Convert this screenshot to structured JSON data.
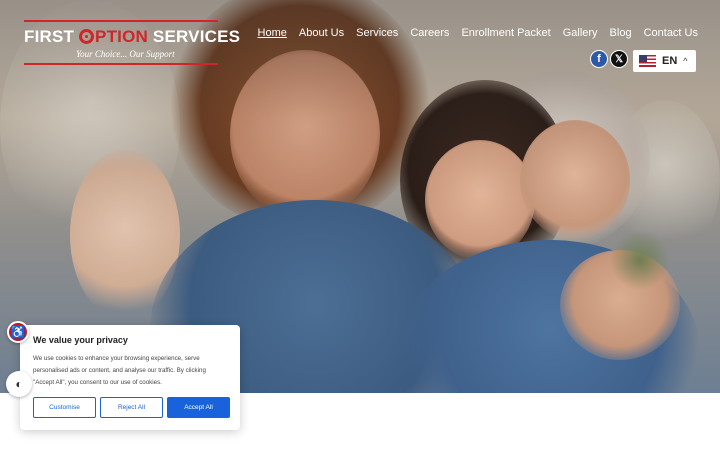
{
  "logo": {
    "brand_first": "FIRST ",
    "brand_option": "PTION",
    "brand_services": " SERVICES",
    "tagline": "Your Choice... Our Support"
  },
  "nav": {
    "items": [
      {
        "label": "Home",
        "active": true
      },
      {
        "label": "About Us"
      },
      {
        "label": "Services"
      },
      {
        "label": "Careers"
      },
      {
        "label": "Enrollment Packet"
      },
      {
        "label": "Gallery"
      },
      {
        "label": "Blog"
      },
      {
        "label": "Contact Us"
      }
    ]
  },
  "social": {
    "facebook_glyph": "f",
    "x_glyph": "𝕏",
    "icons": [
      "facebook-icon",
      "x-twitter-icon"
    ]
  },
  "language": {
    "code": "EN",
    "chevron": "^",
    "flag": "us-flag-icon"
  },
  "accessibility": {
    "a11y_glyph": "♿",
    "contrast_glyph": "◐"
  },
  "cookie_banner": {
    "title": "We value your privacy",
    "message": "We use cookies to enhance your browsing experience, serve personalised ads or content, and analyse our traffic. By clicking \"Accept All\", you consent to our use of cookies.",
    "customise_label": "Customise",
    "reject_label": "Reject All",
    "accept_label": "Accept All"
  },
  "colors": {
    "brand_red": "#d0262a",
    "cookie_blue": "#1863dc"
  }
}
